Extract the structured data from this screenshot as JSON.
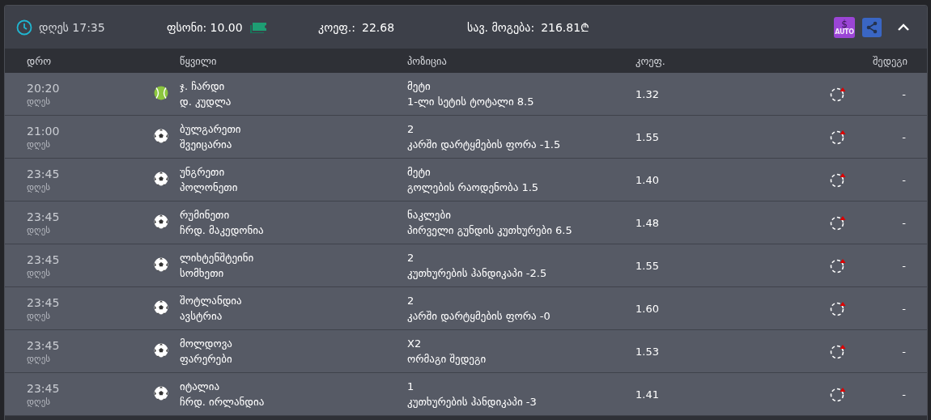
{
  "summary": {
    "time": "დღეს 17:35",
    "stake_label": "ფსონი:",
    "stake_value": "10.00",
    "odds_label": "კოეფ.:",
    "odds_value": "22.68",
    "win_label": "სავ. მოგება:",
    "win_value": "216.81",
    "currency": "₾",
    "auto_symbol": "$",
    "auto_label": "AUTO",
    "expanded": true
  },
  "columns": [
    "დრო",
    "წყვილი",
    "პოზიცია",
    "კოეფ.",
    "შედეგი"
  ],
  "rows": [
    {
      "time": "20:20",
      "day": "დღეს",
      "kind": "tennis",
      "team_1": "ჯ. ჩარდი",
      "team_2": "დ. კუდლა",
      "pick": "მეტი",
      "market": "1-ლი სეტის ტოტალი 8.5",
      "odds": "1.32",
      "result": "-"
    },
    {
      "time": "21:00",
      "day": "დღეს",
      "kind": "football",
      "team_1": "ბულგარეთი",
      "team_2": "შვეიცარია",
      "pick": "2",
      "market": "კარში დარტყმების ფორა -1.5",
      "odds": "1.55",
      "result": "-"
    },
    {
      "time": "23:45",
      "day": "დღეს",
      "kind": "football",
      "team_1": "უნგრეთი",
      "team_2": "პოლონეთი",
      "pick": "მეტი",
      "market": "გოლების რაოდენობა 1.5",
      "odds": "1.40",
      "result": "-"
    },
    {
      "time": "23:45",
      "day": "დღეს",
      "kind": "football",
      "team_1": "რუმინეთი",
      "team_2": "ჩრდ. მაკედონია",
      "pick": "ნაკლები",
      "market": "პირველი გუნდის კუთხურები 6.5",
      "odds": "1.48",
      "result": "-"
    },
    {
      "time": "23:45",
      "day": "დღეს",
      "kind": "football",
      "team_1": "ლიხტენშტეინი",
      "team_2": "სომხეთი",
      "pick": "2",
      "market": "კუთხურების ჰანდიკაპი -2.5",
      "odds": "1.55",
      "result": "-"
    },
    {
      "time": "23:45",
      "day": "დღეს",
      "kind": "football",
      "team_1": "შოტლანდია",
      "team_2": "ავსტრია",
      "pick": "2",
      "market": "კარში დარტყმების ფორა -0",
      "odds": "1.60",
      "result": "-"
    },
    {
      "time": "23:45",
      "day": "დღეს",
      "kind": "football",
      "team_1": "მოლდოვა",
      "team_2": "ფარერები",
      "pick": "X2",
      "market": "ორმაგი შედეგი",
      "odds": "1.53",
      "result": "-"
    },
    {
      "time": "23:45",
      "day": "დღეს",
      "kind": "football",
      "team_1": "იტალია",
      "team_2": "ჩრდ. ირლანდია",
      "pick": "1",
      "market": "კუთხურების ჰანდიკაპი -3",
      "odds": "1.41",
      "result": "-"
    }
  ]
}
